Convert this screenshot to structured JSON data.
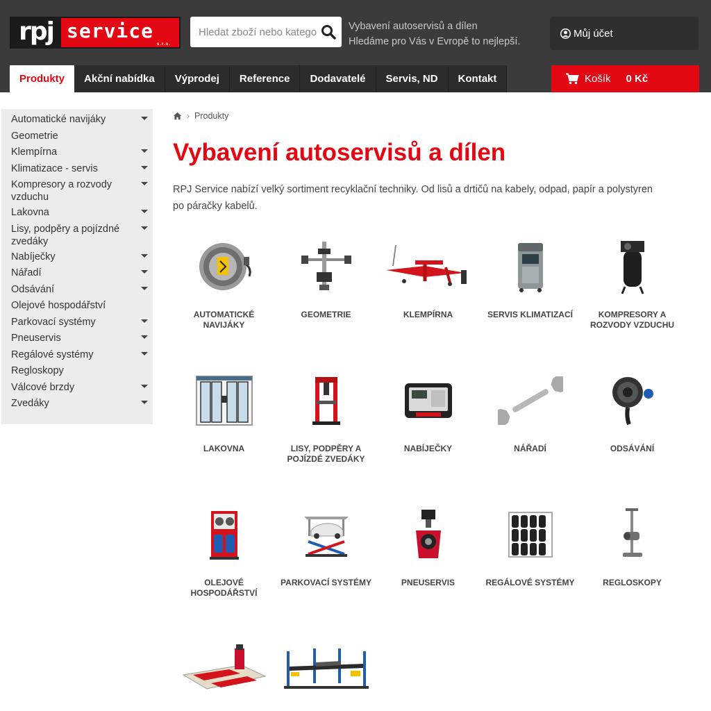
{
  "logo": {
    "brand_left": "rpj",
    "brand_right": "service",
    "brand_suffix": "s.r.o."
  },
  "search": {
    "placeholder": "Hledat zboží nebo kategorie"
  },
  "tagline": {
    "line1": "Vybavení autoservisů a dílen",
    "line2": "Hledáme pro Vás v Evropě to nejlepší."
  },
  "account": {
    "label": "Můj účet"
  },
  "nav": {
    "items": [
      "Produkty",
      "Akční nabídka",
      "Výprodej",
      "Reference",
      "Dodavatelé",
      "Servis, ND",
      "Kontakt"
    ]
  },
  "cart": {
    "label": "Košík",
    "total": "0 Kč"
  },
  "sidebar": {
    "items": [
      {
        "label": "Automatické navijáky"
      },
      {
        "label": "Geometrie"
      },
      {
        "label": "Klempírna"
      },
      {
        "label": "Klimatizace - servis"
      },
      {
        "label": "Kompresory a rozvody vzduchu"
      },
      {
        "label": "Lakovna"
      },
      {
        "label": "Lisy, podpěry a pojízdné zvedáky"
      },
      {
        "label": "Nabíječky"
      },
      {
        "label": "Nářadí"
      },
      {
        "label": "Odsávání"
      },
      {
        "label": "Olejové hospodářství"
      },
      {
        "label": "Parkovací systémy"
      },
      {
        "label": "Pneuservis"
      },
      {
        "label": "Regálové systémy"
      },
      {
        "label": "Regloskopy"
      },
      {
        "label": "Válcové brzdy"
      },
      {
        "label": "Zvedáky"
      }
    ]
  },
  "breadcrumb": {
    "current": "Produkty"
  },
  "page": {
    "title": "Vybavení autoservisů a dílen",
    "intro": "RPJ Service nabízí velký sortiment recyklační techniky. Od lisů a drtičů na kabely, odpad, papír a polystyren po páračky kabelů."
  },
  "categories": [
    {
      "label": "Automatické navijáky",
      "icon": "hose-reel-icon"
    },
    {
      "label": "Geometrie",
      "icon": "wheel-alignment-icon"
    },
    {
      "label": "Klempírna",
      "icon": "frame-bench-icon"
    },
    {
      "label": "Servis klimatizací",
      "icon": "ac-station-icon"
    },
    {
      "label": "Kompresory a rozvody vzduchu",
      "icon": "compressor-icon"
    },
    {
      "label": "Lakovna",
      "icon": "paint-booth-icon"
    },
    {
      "label": "Lisy, podpěry a pojízdé zvedáky",
      "icon": "press-icon"
    },
    {
      "label": "Nabíječky",
      "icon": "charger-icon"
    },
    {
      "label": "Nářadí",
      "icon": "wrench-icon"
    },
    {
      "label": "Odsávání",
      "icon": "exhaust-reel-icon"
    },
    {
      "label": "Olejové hospodářství",
      "icon": "oil-station-icon"
    },
    {
      "label": "Parkovací systémy",
      "icon": "parking-lift-icon"
    },
    {
      "label": "Pneuservis",
      "icon": "wheel-balancer-icon"
    },
    {
      "label": "Regálové systémy",
      "icon": "tire-rack-icon"
    },
    {
      "label": "Regloskopy",
      "icon": "headlight-tester-icon"
    },
    {
      "label": "",
      "icon": "brake-tester-icon"
    },
    {
      "label": "",
      "icon": "four-post-lift-icon"
    }
  ],
  "colors": {
    "accent": "#e30613",
    "header_bg": "#3b3b3b",
    "sidebar_bg": "#ececec"
  }
}
